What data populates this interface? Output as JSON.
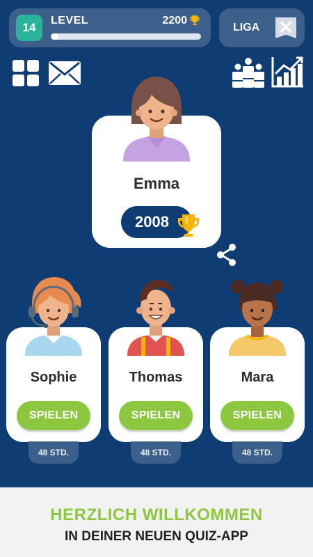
{
  "header": {
    "level_number": "14",
    "level_label": "LEVEL",
    "points": "2200",
    "level_progress": 0.05,
    "league_label": "LIGA"
  },
  "icons": {
    "menu": "grid-icon",
    "messages": "mail-icon",
    "ranking": "ranking-icon",
    "statistics": "stats-icon",
    "share": "share-icon",
    "trophy": "trophy-icon"
  },
  "player": {
    "name": "Emma",
    "score": "2008"
  },
  "opponents": [
    {
      "name": "Sophie",
      "button": "SPIELEN",
      "time": "48 STD."
    },
    {
      "name": "Thomas",
      "button": "SPIELEN",
      "time": "48 STD."
    },
    {
      "name": "Mara",
      "button": "SPIELEN",
      "time": "48 STD."
    }
  ],
  "footer": {
    "title": "HERZLICH WILLKOMMEN",
    "subtitle": "IN DEINER NEUEN QUIZ-APP"
  },
  "colors": {
    "background": "#0f3c73",
    "panel": "#3d5f8c",
    "accent_green": "#8dc63f",
    "level_teal": "#2bb39a",
    "trophy_gold": "#f5b50a"
  }
}
